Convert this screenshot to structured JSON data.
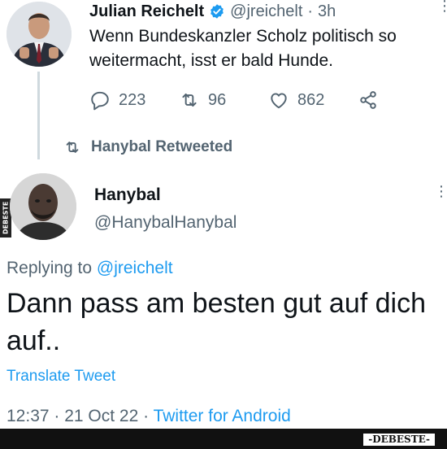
{
  "original_tweet": {
    "author_name": "Julian Reichelt",
    "verified": true,
    "handle": "@jreichelt",
    "separator": "·",
    "time_ago": "3h",
    "text": "Wenn Bundeskanzler Scholz politisch so weitermacht, isst er bald Hunde.",
    "replies": "223",
    "retweets": "96",
    "likes": "862",
    "colors": {
      "verified": "#1d9bf0"
    }
  },
  "retweet_banner": {
    "label": "Hanybal Retweeted"
  },
  "reply_tweet": {
    "author_name": "Hanybal",
    "handle": "@HanybalHanybal",
    "replying_prefix": "Replying to ",
    "replying_handle": "@jreichelt",
    "text": "Dann pass am besten gut auf dich auf..",
    "translate_label": "Translate Tweet",
    "timestamp": "12:37 · 21 Oct 22 · ",
    "source": "Twitter for Android",
    "colors": {
      "link": "#1d9bf0"
    }
  },
  "watermark": {
    "bottom": "-DEBESTE-",
    "side": "DEBESTE"
  },
  "icons": [
    "reply-icon",
    "retweet-icon",
    "like-icon",
    "share-icon",
    "verified-badge-icon",
    "more-icon"
  ]
}
